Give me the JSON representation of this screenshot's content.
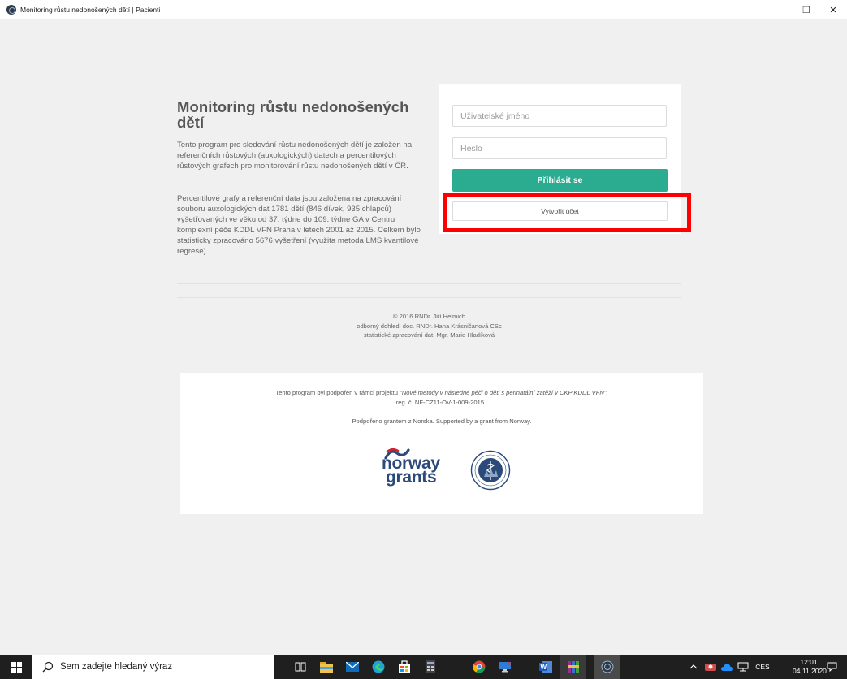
{
  "window": {
    "title": "Monitoring růstu nedonošených dětí | Pacienti",
    "controls": {
      "minimize": "–",
      "maximize": "❐",
      "close": "✕"
    }
  },
  "intro": {
    "title": "Monitoring růstu nedonošených dětí",
    "paragraph1": "Tento program pro sledování růstu nedonošených dětí je založen na referenčních růstových (auxologických) datech a percentilových růstových grafech pro monitorování růstu nedonošených dětí v ČR.",
    "paragraph2": "Percentilové grafy a referenční data jsou založena na zpracování souboru auxologických dat 1781 dětí (846 dívek, 935 chlapců) vyšetřovaných ve věku od 37. týdne do 109. týdne GA v Centru komplexní péče KDDL VFN Praha v letech 2001 až 2015. Celkem bylo statisticky zpracováno 5676 vyšetření (využita metoda LMS kvantilové regrese)."
  },
  "login": {
    "username_placeholder": "Uživatelské jméno",
    "username_value": "",
    "password_placeholder": "Heslo",
    "password_value": "",
    "login_button": "Přihlásit se",
    "create_account_button": "Vytvořit účet"
  },
  "credits": {
    "copyright": "© 2016 RNDr. Jiří Helmich",
    "supervision": "odborný dohled: doc. RNDr. Hana Krásničanová CSc",
    "statistics": "statistické zpracování dat: Mgr. Marie Hladíková"
  },
  "support": {
    "project_prefix": "Tento program byl podpořen v rámci projektu ",
    "project_name": "\"Nové metody v následné péči o děti s perinatální zátěží v CKP KDDL VFN\",",
    "registration": "reg. č. NF-CZ11-OV-1-009-2015 .",
    "grant_note": "Podpořeno grantem z Norska. Supported by a grant from Norway.",
    "norway_logo_line1": "norway",
    "norway_logo_line2": "grants",
    "seal_text": "VŠEOBECNÁ FAKULTNÍ NEMOCNICE V PRAZE"
  },
  "taskbar": {
    "search_placeholder": "Sem zadejte hledaný výraz",
    "language": "CES",
    "time": "12:01",
    "date": "04.11.2020",
    "pinned_icons": [
      "task-view-icon",
      "file-explorer-icon",
      "mail-icon",
      "edge-icon",
      "store-icon",
      "calculator-icon",
      "chrome-icon",
      "remote-desktop-icon",
      "word-icon",
      "winrar-icon",
      "app-icon"
    ]
  },
  "colors": {
    "accent": "#2bab8f",
    "highlight": "#ff0000",
    "background": "#f0f0f0",
    "taskbar": "#1f1f1f",
    "logo_blue": "#2b4a7a",
    "logo_red": "#d2232a"
  }
}
